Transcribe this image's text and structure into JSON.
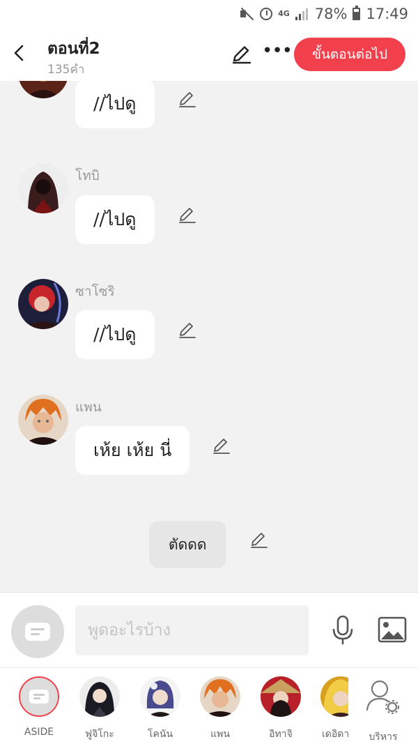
{
  "status_bar": {
    "network": "4G",
    "battery": "78%",
    "time": "17:49"
  },
  "header": {
    "title": "ตอนที่2",
    "word_count": "135คำ",
    "next_button": "ขั้นตอนต่อไป"
  },
  "messages": [
    {
      "sender": "",
      "text": "//ไปดู"
    },
    {
      "sender": "โทบิ",
      "text": "//ไปดู"
    },
    {
      "sender": "ซาโซริ",
      "text": "//ไปดู"
    },
    {
      "sender": "แพน",
      "text": "เห้ย เห้ย นี่"
    }
  ],
  "narration": {
    "text": "ตัดดด"
  },
  "input": {
    "placeholder": "พูดอะไรบ้าง"
  },
  "characters": [
    {
      "label": "ASIDE"
    },
    {
      "label": "ฟูจิโกะ"
    },
    {
      "label": "โคนัน"
    },
    {
      "label": "แพน"
    },
    {
      "label": "อิทาจิ"
    },
    {
      "label": "เดอิดา"
    },
    {
      "label": "บริหาร"
    }
  ],
  "colors": {
    "accent": "#f2414d",
    "background": "#f2f2f2"
  }
}
